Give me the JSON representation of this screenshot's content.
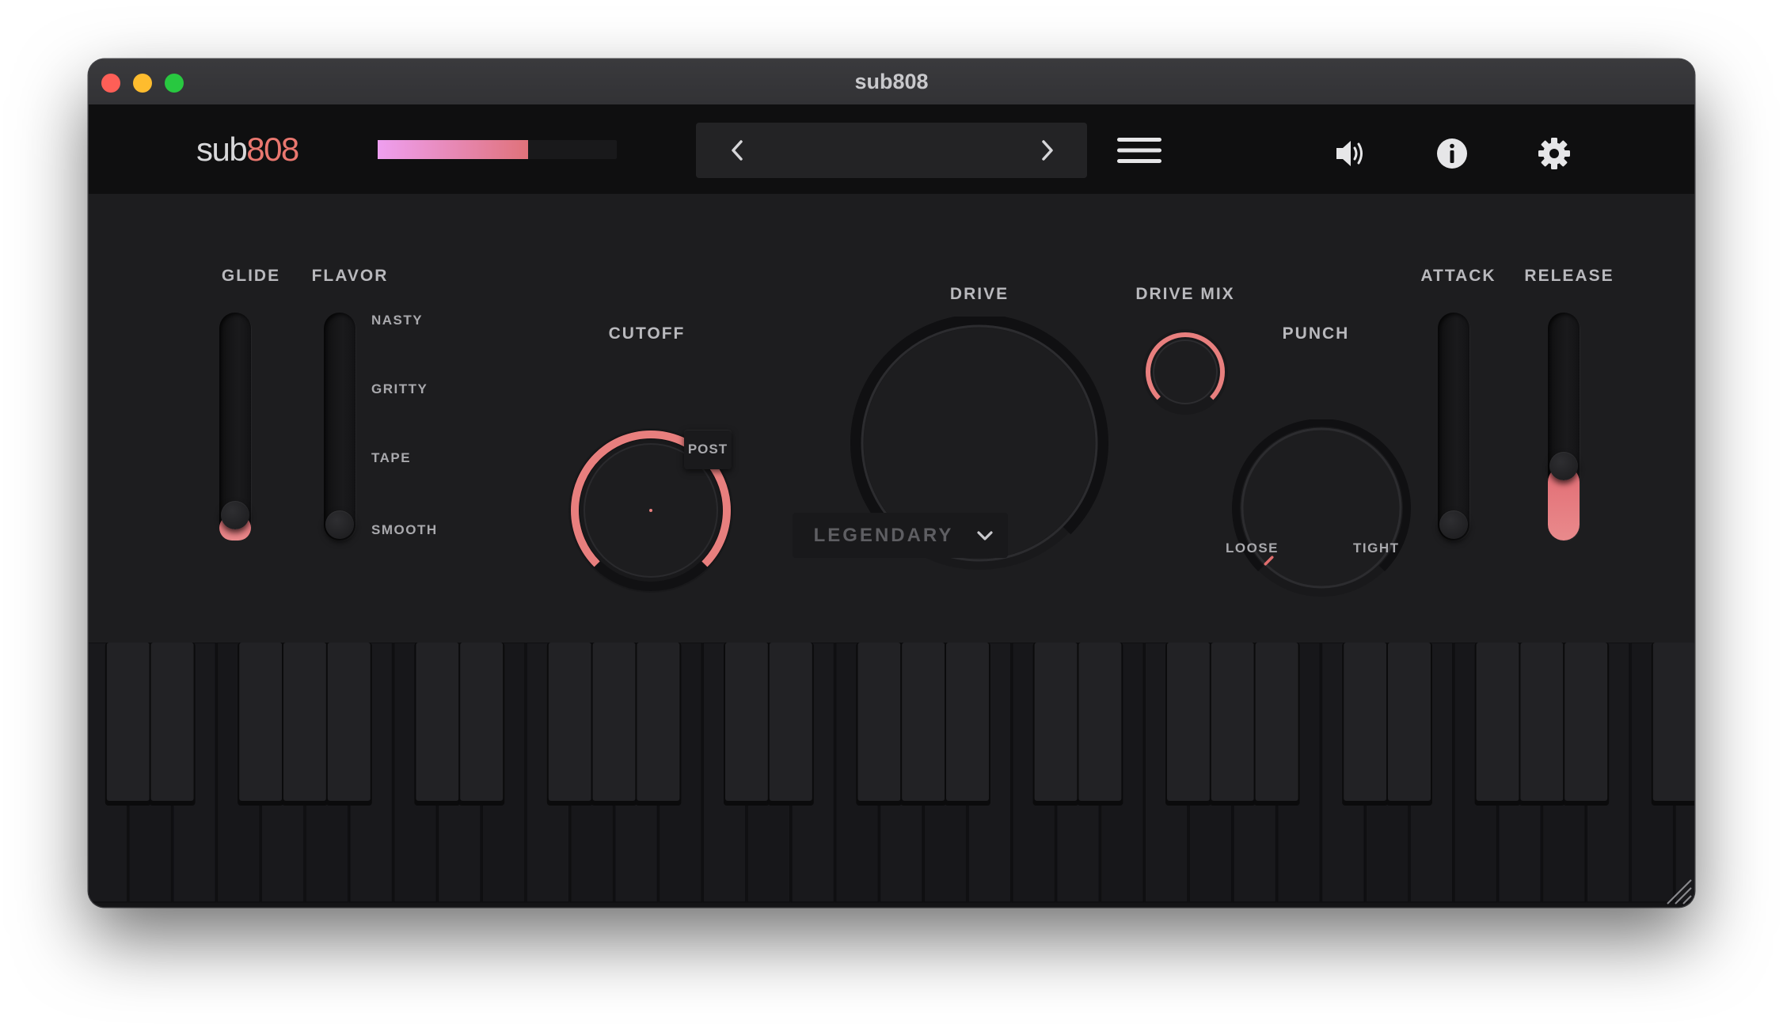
{
  "window": {
    "title": "sub808"
  },
  "header": {
    "brand_part1": "sub",
    "brand_part2": "808",
    "output_level": 0.63,
    "preset_name": "",
    "icons": [
      "chevron-left-icon",
      "chevron-right-icon",
      "hamburger-menu-icon",
      "speaker-icon",
      "info-icon",
      "gear-icon"
    ]
  },
  "controls": {
    "glide": {
      "label": "GLIDE",
      "value": 0.05
    },
    "flavor": {
      "label": "FLAVOR",
      "options": [
        "NASTY",
        "GRITTY",
        "TAPE",
        "SMOOTH"
      ],
      "selected": "SMOOTH"
    },
    "cutoff": {
      "label": "CUTOFF",
      "value": 1.0
    },
    "post_button": "POST",
    "drive": {
      "label": "DRIVE",
      "value": 0.0
    },
    "drive_mix": {
      "label": "DRIVE MIX",
      "value": 1.0
    },
    "punch": {
      "label": "PUNCH",
      "value": 0.0,
      "min_label": "LOOSE",
      "max_label": "TIGHT"
    },
    "attack": {
      "label": "ATTACK",
      "value": 0.0
    },
    "release": {
      "label": "RELEASE",
      "value": 0.3
    },
    "mode_dropdown": "LEGENDARY"
  },
  "colors": {
    "accent": "#e9776f",
    "meter_start": "#ee9ff0",
    "meter_end": "#e0727a",
    "panel": "#1d1d1f",
    "header": "#0f0f10"
  }
}
